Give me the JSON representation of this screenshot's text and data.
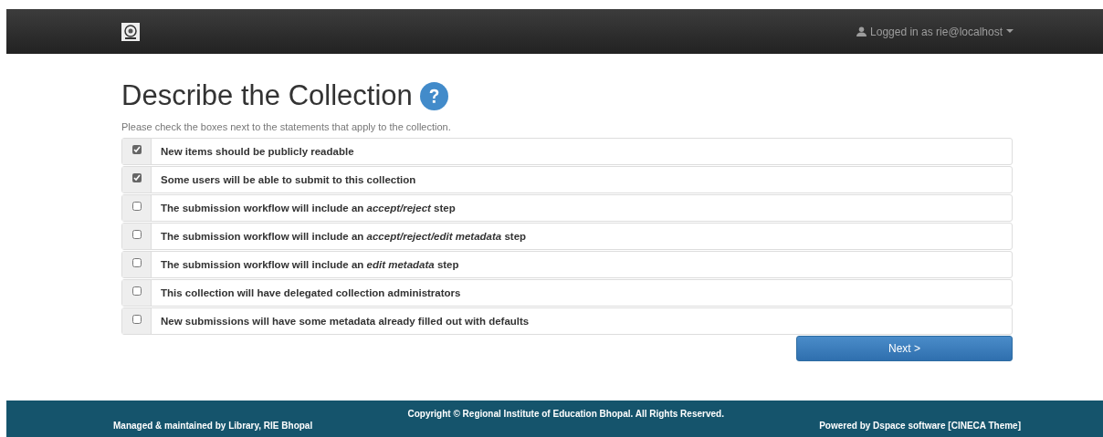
{
  "navbar": {
    "user_label": "Logged in as rie@localhost"
  },
  "page": {
    "title": "Describe the Collection",
    "instructions": "Please check the boxes next to the statements that apply to the collection."
  },
  "options": [
    {
      "label": "New items should be publicly readable",
      "checked": true
    },
    {
      "label": "Some users will be able to submit to this collection",
      "checked": true
    },
    {
      "label": "The submission workflow will include an *accept/reject* step",
      "checked": false
    },
    {
      "label": "The submission workflow will include an *accept/reject/edit metadata* step",
      "checked": false
    },
    {
      "label": "The submission workflow will include an *edit metadata* step",
      "checked": false
    },
    {
      "label": "This collection will have delegated collection administrators",
      "checked": false
    },
    {
      "label": "New submissions will have some metadata already filled out with defaults",
      "checked": false
    }
  ],
  "next_button": "Next >",
  "footer": {
    "left": "Managed & maintained by Library, RIE Bhopal",
    "center": "Copyright © Regional Institute of Education Bhopal. All Rights Reserved.",
    "right": "Powered by Dspace software [CINECA Theme]"
  }
}
